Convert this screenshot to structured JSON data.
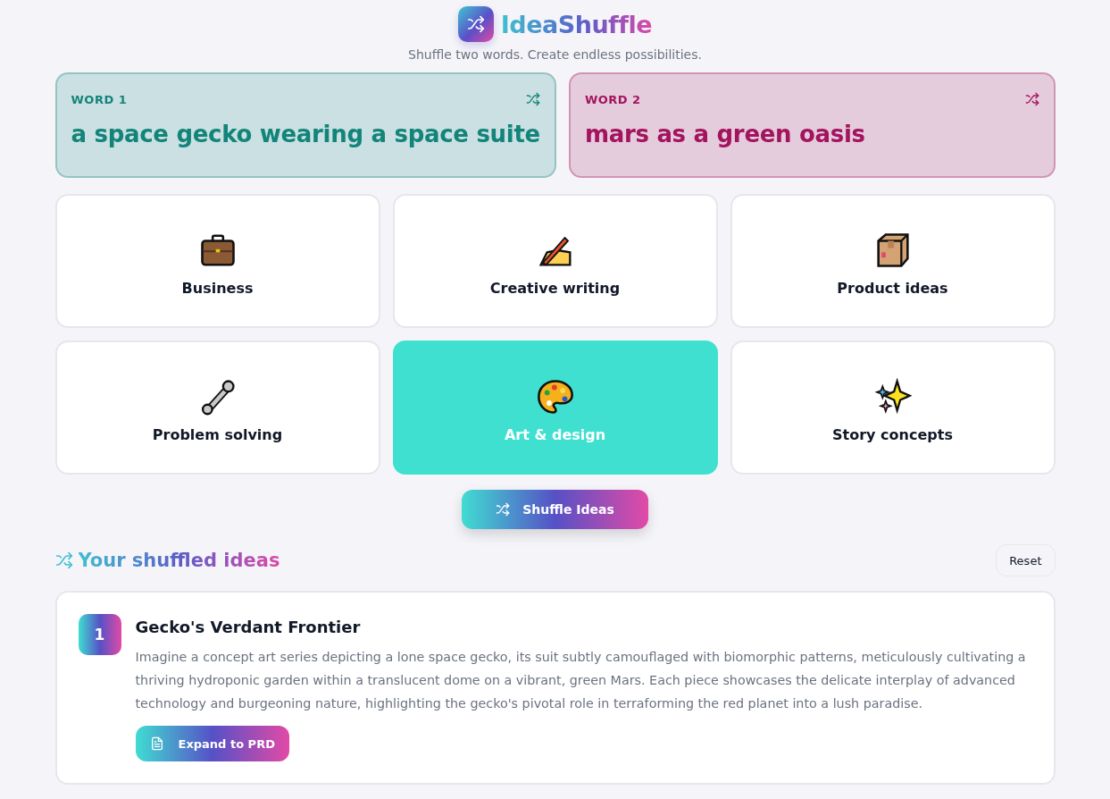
{
  "app": {
    "title": "IdeaShuffle",
    "tagline": "Shuffle two words. Create endless possibilities."
  },
  "words": [
    {
      "label": "WORD 1",
      "value": "a space gecko wearing a space suite",
      "color": "#13847a"
    },
    {
      "label": "WORD 2",
      "value": "mars as a green oasis",
      "color": "#a3145e"
    }
  ],
  "categories": [
    {
      "label": "Business",
      "selected": false
    },
    {
      "label": "Creative writing",
      "selected": false
    },
    {
      "label": "Product ideas",
      "selected": false
    },
    {
      "label": "Problem solving",
      "selected": false
    },
    {
      "label": "Art & design",
      "selected": true
    },
    {
      "label": "Story concepts",
      "selected": false
    }
  ],
  "shuffle_button": "Shuffle Ideas",
  "results": {
    "title": "Your shuffled ideas",
    "reset_button": "Reset",
    "ideas": [
      {
        "number": "1",
        "title": "Gecko's Verdant Frontier",
        "description": "Imagine a concept art series depicting a lone space gecko, its suit subtly camouflaged with biomorphic patterns, meticulously cultivating a thriving hydroponic garden within a translucent dome on a vibrant, green Mars. Each piece showcases the delicate interplay of advanced technology and burgeoning nature, highlighting the gecko's pivotal role in terraforming the red planet into a lush paradise.",
        "action": "Expand to PRD"
      }
    ]
  }
}
